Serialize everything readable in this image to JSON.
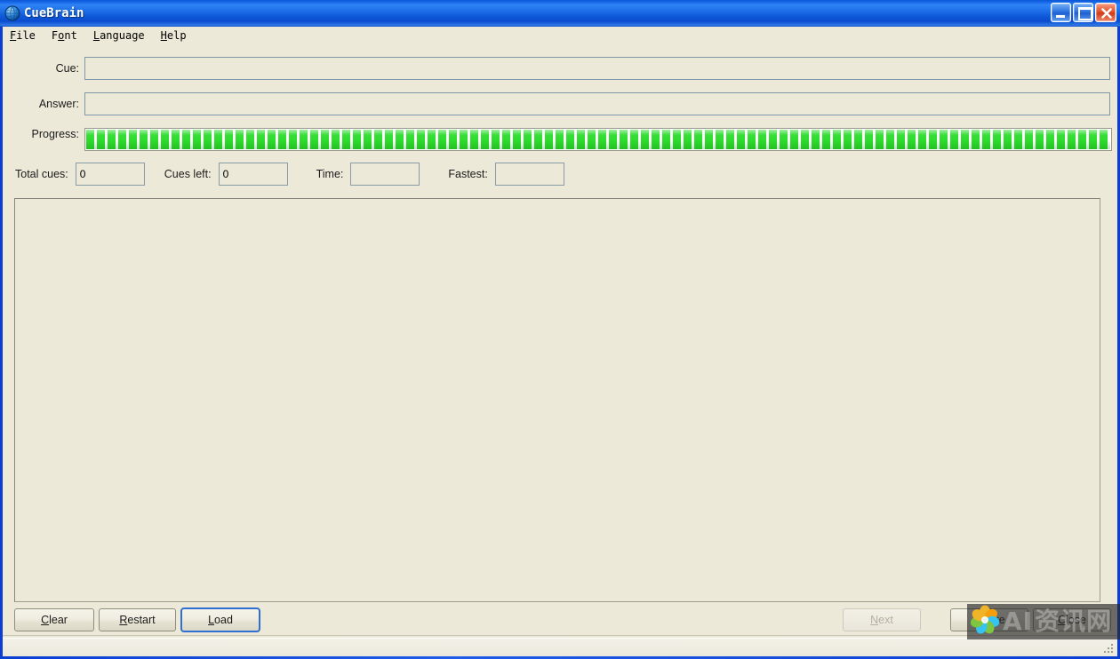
{
  "window": {
    "title": "CueBrain",
    "icon": "globe-icon",
    "controls": {
      "minimize": "Minimize",
      "maximize": "Maximize",
      "close": "Close"
    },
    "colors": {
      "titlebar_blue": "#0b4ccf",
      "client_beige": "#ECE9D8",
      "progress_green": "#2ddc2d",
      "focus_blue": "#2f6fd0",
      "field_border": "#8a9ba8"
    }
  },
  "menubar": {
    "items": [
      {
        "label": "File",
        "mnemonic": "F"
      },
      {
        "label": "Font",
        "mnemonic": "F"
      },
      {
        "label": "Language",
        "mnemonic": "L"
      },
      {
        "label": "Help",
        "mnemonic": "H"
      }
    ]
  },
  "form": {
    "cue": {
      "label": "Cue:",
      "value": "",
      "placeholder": ""
    },
    "answer": {
      "label": "Answer:",
      "value": "",
      "placeholder": ""
    },
    "progress": {
      "label": "Progress:",
      "percent": 100
    },
    "stats": [
      {
        "label": "Total cues:",
        "value": "0"
      },
      {
        "label": "Cues left:",
        "value": "0"
      },
      {
        "label": "Time:",
        "value": ""
      },
      {
        "label": "Fastest:",
        "value": ""
      }
    ]
  },
  "output": {
    "text": ""
  },
  "buttons": {
    "left": [
      {
        "label": "Clear",
        "mnemonic": "C",
        "state": "normal"
      },
      {
        "label": "Restart",
        "mnemonic": "R",
        "state": "normal"
      },
      {
        "label": "Load",
        "mnemonic": "L",
        "state": "focused"
      }
    ],
    "right": [
      {
        "label": "Next",
        "mnemonic": "N",
        "state": "disabled"
      },
      {
        "label": "Ignore",
        "mnemonic": "I",
        "state": "normal"
      },
      {
        "label": "Close",
        "mnemonic": "C",
        "state": "normal"
      }
    ]
  },
  "statusbar": {
    "text": ""
  },
  "watermark": {
    "logo": "flower-logo-icon",
    "text_latin": "AI",
    "text_cjk": "资讯网"
  }
}
